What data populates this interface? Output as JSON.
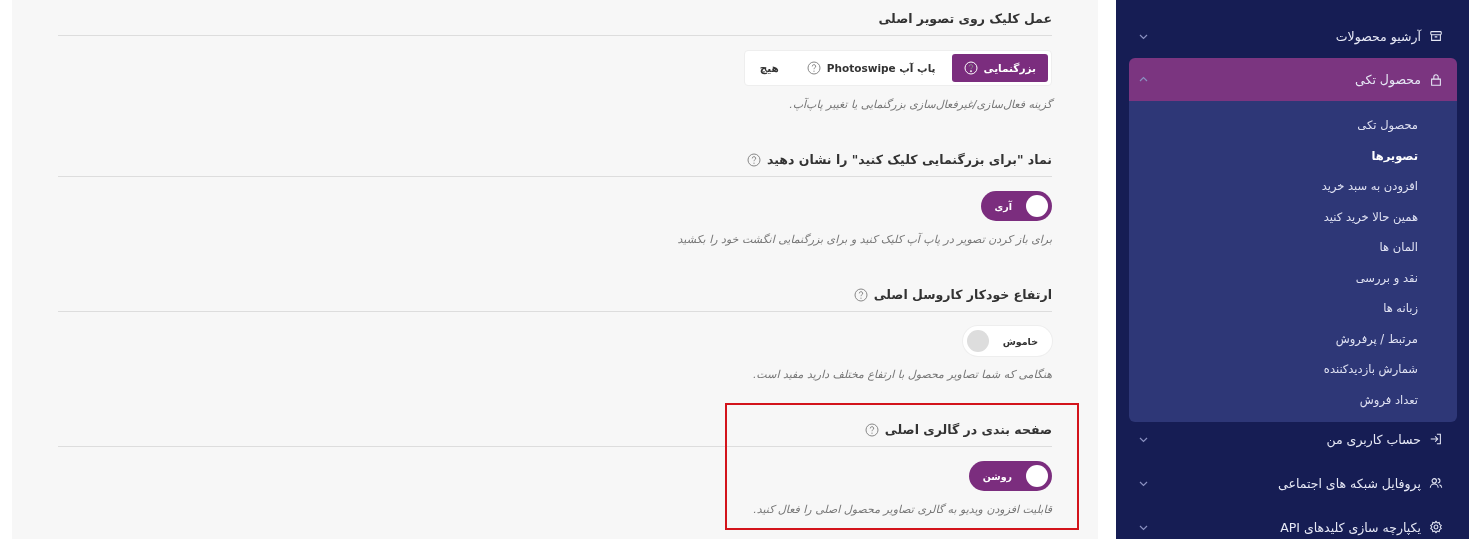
{
  "settings": [
    {
      "kind": "segmented",
      "title": "عمل کلیک روی تصویر اصلی",
      "help": false,
      "highlighted": false,
      "options": [
        {
          "label": "بزرگنمایی",
          "help": true,
          "selected": true
        },
        {
          "label": "پاپ آپ Photoswipe",
          "help": true,
          "selected": false
        },
        {
          "label": "هیچ",
          "help": false,
          "selected": false
        }
      ],
      "description": "گزینه فعال‌سازی/غیرفعال‌سازی بزرگنمایی یا تغییر پاپ‌آپ."
    },
    {
      "kind": "toggle",
      "title": "نماد \"برای بزرگنمایی کلیک کنید\" را نشان دهید",
      "help": true,
      "highlighted": false,
      "on": true,
      "state_label": "آری",
      "description": "برای باز کردن تصویر در پاپ آپ کلیک کنید و برای بزرگنمایی انگشت خود را بکشید"
    },
    {
      "kind": "toggle",
      "title": "ارتفاع خودکار کاروسل اصلی",
      "help": true,
      "highlighted": false,
      "on": false,
      "state_label": "خاموش",
      "description": "هنگامی که شما تصاویر محصول با ارتفاع مختلف دارید مفید است."
    },
    {
      "kind": "toggle",
      "title": "صفحه بندی در گالری اصلی",
      "help": true,
      "highlighted": true,
      "on": true,
      "state_label": "روشن",
      "description": "قابلیت افزودن ویدیو به گالری تصاویر محصول اصلی را فعال کنید."
    }
  ],
  "sidebar": {
    "items": [
      {
        "label": "آرشیو محصولات",
        "expanded": false,
        "selected": false
      },
      {
        "label": "محصول تکی",
        "expanded": true,
        "selected": true,
        "children": [
          {
            "label": "محصول تکی",
            "selected": false
          },
          {
            "label": "تصویرها",
            "selected": true
          },
          {
            "label": "افزودن به سبد خرید",
            "selected": false
          },
          {
            "label": "همین حالا خرید کنید",
            "selected": false
          },
          {
            "label": "المان ها",
            "selected": false
          },
          {
            "label": "نقد و بررسی",
            "selected": false
          },
          {
            "label": "زبانه ها",
            "selected": false
          },
          {
            "label": "مرتبط / پرفروش",
            "selected": false
          },
          {
            "label": "شمارش بازدیدکننده",
            "selected": false
          },
          {
            "label": "تعداد فروش",
            "selected": false
          }
        ]
      },
      {
        "label": "حساب کاربری من",
        "expanded": false,
        "selected": false
      },
      {
        "label": "پروفایل شبکه های اجتماعی",
        "expanded": false,
        "selected": false
      },
      {
        "label": "یکپارچه سازی کلیدهای API",
        "expanded": false,
        "selected": false
      }
    ]
  }
}
